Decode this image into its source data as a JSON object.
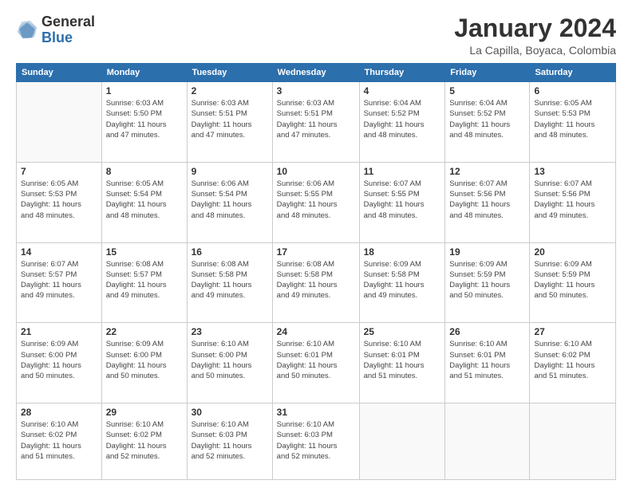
{
  "header": {
    "logo_general": "General",
    "logo_blue": "Blue",
    "month_title": "January 2024",
    "subtitle": "La Capilla, Boyaca, Colombia"
  },
  "weekdays": [
    "Sunday",
    "Monday",
    "Tuesday",
    "Wednesday",
    "Thursday",
    "Friday",
    "Saturday"
  ],
  "weeks": [
    [
      {
        "day": "",
        "info": ""
      },
      {
        "day": "1",
        "info": "Sunrise: 6:03 AM\nSunset: 5:50 PM\nDaylight: 11 hours\nand 47 minutes."
      },
      {
        "day": "2",
        "info": "Sunrise: 6:03 AM\nSunset: 5:51 PM\nDaylight: 11 hours\nand 47 minutes."
      },
      {
        "day": "3",
        "info": "Sunrise: 6:03 AM\nSunset: 5:51 PM\nDaylight: 11 hours\nand 47 minutes."
      },
      {
        "day": "4",
        "info": "Sunrise: 6:04 AM\nSunset: 5:52 PM\nDaylight: 11 hours\nand 48 minutes."
      },
      {
        "day": "5",
        "info": "Sunrise: 6:04 AM\nSunset: 5:52 PM\nDaylight: 11 hours\nand 48 minutes."
      },
      {
        "day": "6",
        "info": "Sunrise: 6:05 AM\nSunset: 5:53 PM\nDaylight: 11 hours\nand 48 minutes."
      }
    ],
    [
      {
        "day": "7",
        "info": "Sunrise: 6:05 AM\nSunset: 5:53 PM\nDaylight: 11 hours\nand 48 minutes."
      },
      {
        "day": "8",
        "info": "Sunrise: 6:05 AM\nSunset: 5:54 PM\nDaylight: 11 hours\nand 48 minutes."
      },
      {
        "day": "9",
        "info": "Sunrise: 6:06 AM\nSunset: 5:54 PM\nDaylight: 11 hours\nand 48 minutes."
      },
      {
        "day": "10",
        "info": "Sunrise: 6:06 AM\nSunset: 5:55 PM\nDaylight: 11 hours\nand 48 minutes."
      },
      {
        "day": "11",
        "info": "Sunrise: 6:07 AM\nSunset: 5:55 PM\nDaylight: 11 hours\nand 48 minutes."
      },
      {
        "day": "12",
        "info": "Sunrise: 6:07 AM\nSunset: 5:56 PM\nDaylight: 11 hours\nand 48 minutes."
      },
      {
        "day": "13",
        "info": "Sunrise: 6:07 AM\nSunset: 5:56 PM\nDaylight: 11 hours\nand 49 minutes."
      }
    ],
    [
      {
        "day": "14",
        "info": "Sunrise: 6:07 AM\nSunset: 5:57 PM\nDaylight: 11 hours\nand 49 minutes."
      },
      {
        "day": "15",
        "info": "Sunrise: 6:08 AM\nSunset: 5:57 PM\nDaylight: 11 hours\nand 49 minutes."
      },
      {
        "day": "16",
        "info": "Sunrise: 6:08 AM\nSunset: 5:58 PM\nDaylight: 11 hours\nand 49 minutes."
      },
      {
        "day": "17",
        "info": "Sunrise: 6:08 AM\nSunset: 5:58 PM\nDaylight: 11 hours\nand 49 minutes."
      },
      {
        "day": "18",
        "info": "Sunrise: 6:09 AM\nSunset: 5:58 PM\nDaylight: 11 hours\nand 49 minutes."
      },
      {
        "day": "19",
        "info": "Sunrise: 6:09 AM\nSunset: 5:59 PM\nDaylight: 11 hours\nand 50 minutes."
      },
      {
        "day": "20",
        "info": "Sunrise: 6:09 AM\nSunset: 5:59 PM\nDaylight: 11 hours\nand 50 minutes."
      }
    ],
    [
      {
        "day": "21",
        "info": "Sunrise: 6:09 AM\nSunset: 6:00 PM\nDaylight: 11 hours\nand 50 minutes."
      },
      {
        "day": "22",
        "info": "Sunrise: 6:09 AM\nSunset: 6:00 PM\nDaylight: 11 hours\nand 50 minutes."
      },
      {
        "day": "23",
        "info": "Sunrise: 6:10 AM\nSunset: 6:00 PM\nDaylight: 11 hours\nand 50 minutes."
      },
      {
        "day": "24",
        "info": "Sunrise: 6:10 AM\nSunset: 6:01 PM\nDaylight: 11 hours\nand 50 minutes."
      },
      {
        "day": "25",
        "info": "Sunrise: 6:10 AM\nSunset: 6:01 PM\nDaylight: 11 hours\nand 51 minutes."
      },
      {
        "day": "26",
        "info": "Sunrise: 6:10 AM\nSunset: 6:01 PM\nDaylight: 11 hours\nand 51 minutes."
      },
      {
        "day": "27",
        "info": "Sunrise: 6:10 AM\nSunset: 6:02 PM\nDaylight: 11 hours\nand 51 minutes."
      }
    ],
    [
      {
        "day": "28",
        "info": "Sunrise: 6:10 AM\nSunset: 6:02 PM\nDaylight: 11 hours\nand 51 minutes."
      },
      {
        "day": "29",
        "info": "Sunrise: 6:10 AM\nSunset: 6:02 PM\nDaylight: 11 hours\nand 52 minutes."
      },
      {
        "day": "30",
        "info": "Sunrise: 6:10 AM\nSunset: 6:03 PM\nDaylight: 11 hours\nand 52 minutes."
      },
      {
        "day": "31",
        "info": "Sunrise: 6:10 AM\nSunset: 6:03 PM\nDaylight: 11 hours\nand 52 minutes."
      },
      {
        "day": "",
        "info": ""
      },
      {
        "day": "",
        "info": ""
      },
      {
        "day": "",
        "info": ""
      }
    ]
  ]
}
